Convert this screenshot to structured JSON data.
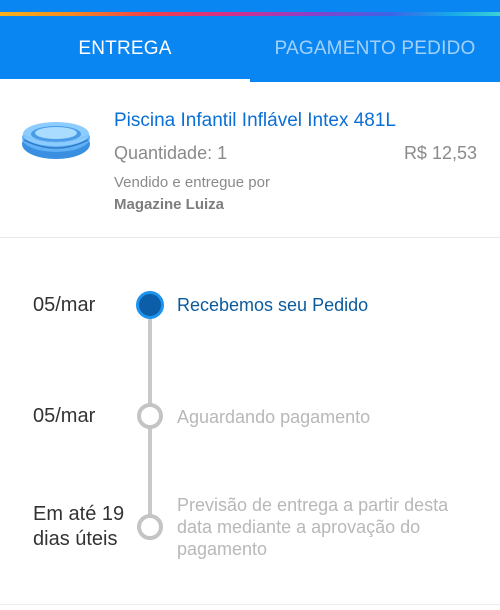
{
  "tabs": {
    "entrega": "ENTREGA",
    "pagamento": "PAGAMENTO PEDIDO",
    "active": "ENTREGA"
  },
  "product": {
    "name": "Piscina Infantil Inflável Intex 481L",
    "quantity_label": "Quantidade: 1",
    "price": "R$ 12,53",
    "sold_by_label": "Vendido e entregue por",
    "seller": "Magazine Luiza",
    "thumbnail_icon": "inflatable-pool-image"
  },
  "timeline": {
    "steps": [
      {
        "date": "05/mar",
        "label": "Recebemos seu Pedido",
        "status": "done"
      },
      {
        "date": "05/mar",
        "label": "Aguardando pagamento",
        "status": "pending"
      },
      {
        "date": "Em até 19 dias úteis",
        "label": "Previsão de entrega a partir desta data mediante a aprovação do pagamento",
        "status": "pending"
      }
    ]
  },
  "colors": {
    "header_blue": "#0a86f3",
    "link_blue": "#0a6fd6",
    "active_step_blue": "#0b5a9c",
    "inactive_grey": "#b8b8b8"
  }
}
